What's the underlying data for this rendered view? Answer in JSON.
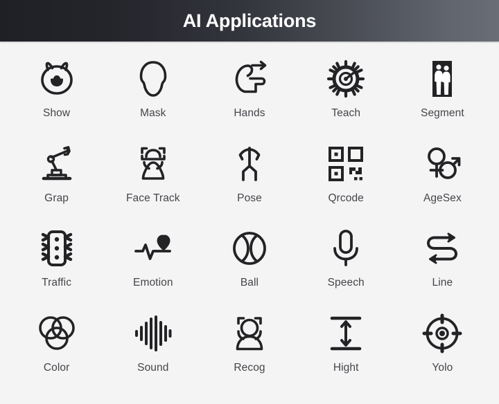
{
  "header": {
    "title": "AI Applications",
    "bg_gradient_from": "#1f2026",
    "bg_gradient_to": "#696d75",
    "title_color": "#ffffff"
  },
  "page": {
    "background_color": "#f4f4f5",
    "icon_color": "#232326",
    "label_color": "#45454a",
    "columns": 5,
    "rows": 4
  },
  "grid": {
    "items": [
      {
        "label": "Show",
        "icon": "cat-face-icon"
      },
      {
        "label": "Mask",
        "icon": "head-outline-icon"
      },
      {
        "label": "Hands",
        "icon": "hand-swipe-icon"
      },
      {
        "label": "Teach",
        "icon": "gear-icon"
      },
      {
        "label": "Segment",
        "icon": "people-segment-icon"
      },
      {
        "label": "Grap",
        "icon": "robot-arm-icon"
      },
      {
        "label": "Face Track",
        "icon": "face-track-icon"
      },
      {
        "label": "Pose",
        "icon": "stick-figure-icon"
      },
      {
        "label": "Qrcode",
        "icon": "qr-code-icon"
      },
      {
        "label": "AgeSex",
        "icon": "gender-symbols-icon"
      },
      {
        "label": "Traffic",
        "icon": "traffic-light-icon"
      },
      {
        "label": "Emotion",
        "icon": "heartbeat-heart-icon"
      },
      {
        "label": "Ball",
        "icon": "ball-icon"
      },
      {
        "label": "Speech",
        "icon": "microphone-icon"
      },
      {
        "label": "Line",
        "icon": "s-path-arrows-icon"
      },
      {
        "label": "Color",
        "icon": "venn-circles-icon"
      },
      {
        "label": "Sound",
        "icon": "waveform-icon"
      },
      {
        "label": "Recog",
        "icon": "person-brackets-icon"
      },
      {
        "label": "Hight",
        "icon": "height-arrow-icon"
      },
      {
        "label": "Yolo",
        "icon": "crosshair-icon"
      }
    ]
  }
}
